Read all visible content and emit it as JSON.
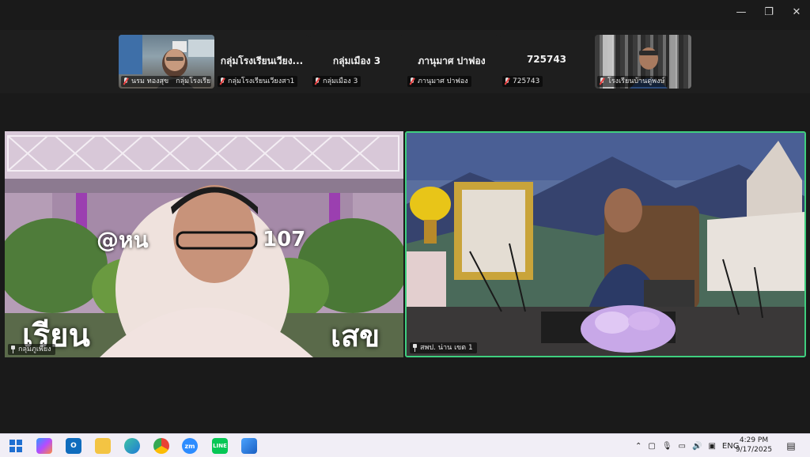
{
  "window": {
    "minimize_glyph": "—",
    "maximize_glyph": "❐",
    "close_glyph": "✕"
  },
  "strip": {
    "tiles": [
      {
        "type": "video",
        "label": "นรม ทองสุข"
      },
      {
        "type": "name",
        "display_name": "กลุ่มโรงเรียนเวียง...",
        "label": "กลุ่มโรงเรียนเวียงสา1"
      },
      {
        "type": "name",
        "display_name": "กลุ่มเมือง 3",
        "label": "กลุ่มเมือง 3"
      },
      {
        "type": "name",
        "display_name": "ภานุมาศ ปาฟอง",
        "label": "ภานุมาศ ปาฟอง"
      },
      {
        "type": "name",
        "display_name": "725743",
        "label": "725743"
      },
      {
        "type": "video",
        "label": "โรงเรียนบ้านดู่พงษ์"
      }
    ]
  },
  "main": {
    "left": {
      "label": "กลุ่มภูเพียง",
      "banner_top": "@หน",
      "banner_number": "107",
      "banner_bottom_left": "เรียน",
      "banner_bottom_right": "เสข"
    },
    "right": {
      "label": "สพป. น่าน เขต 1"
    }
  },
  "taskbar": {
    "apps": [
      "windows-start",
      "copilot",
      "outlook",
      "file-explorer",
      "edge",
      "chrome",
      "zoom",
      "line",
      "photos"
    ],
    "language": "ENG",
    "time": "4:29 PM",
    "date": "9/17/2025"
  },
  "colors": {
    "active_speaker_border": "#3fcf7f",
    "muted_red": "#e84040",
    "background": "#1a1a1a"
  }
}
